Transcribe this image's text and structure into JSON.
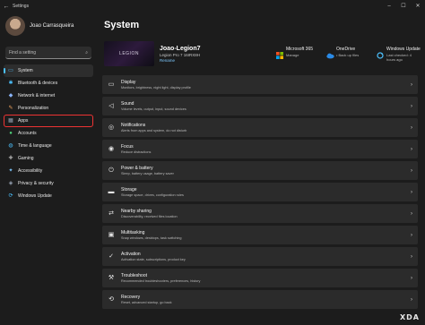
{
  "window": {
    "title": "Settings",
    "back_icon": "back-arrow-icon",
    "controls": [
      "–",
      "☐",
      "✕"
    ]
  },
  "user": {
    "name": "Joao Carrasqueira"
  },
  "search": {
    "placeholder": "Find a setting"
  },
  "sidebar": {
    "items": [
      {
        "label": "System",
        "icon": "system-icon",
        "color": "#4cc2ff",
        "active": true
      },
      {
        "label": "Bluetooth & devices",
        "icon": "bluetooth-icon",
        "color": "#4cc2ff"
      },
      {
        "label": "Network & internet",
        "icon": "network-icon",
        "color": "#8ab4f8"
      },
      {
        "label": "Personalization",
        "icon": "brush-icon",
        "color": "#f0a35e"
      },
      {
        "label": "Apps",
        "icon": "apps-icon",
        "color": "#9aa6b8",
        "highlighted": true
      },
      {
        "label": "Accounts",
        "icon": "accounts-icon",
        "color": "#4fd17a"
      },
      {
        "label": "Time & language",
        "icon": "globe-icon",
        "color": "#4cc2ff"
      },
      {
        "label": "Gaming",
        "icon": "gaming-icon",
        "color": "#b0b0b0"
      },
      {
        "label": "Accessibility",
        "icon": "accessibility-icon",
        "color": "#7ec8ff"
      },
      {
        "label": "Privacy & security",
        "icon": "shield-icon",
        "color": "#9aa6b8"
      },
      {
        "label": "Windows Update",
        "icon": "update-icon",
        "color": "#4cc2ff"
      }
    ]
  },
  "main": {
    "title": "System",
    "device": {
      "image_text": "LEGION",
      "name": "Joao-Legion7",
      "model": "Legion Pro 7 16IRX8H",
      "rename": "Rename"
    },
    "tiles": [
      {
        "name": "Microsoft 365",
        "sub": "Manage",
        "icon": "microsoft365-icon"
      },
      {
        "name": "OneDrive",
        "sub": "• Back up files",
        "icon": "onedrive-icon"
      },
      {
        "name": "Windows Update",
        "sub": "Last checked: 4 hours ago",
        "icon": "windows-update-icon"
      }
    ],
    "cards": [
      {
        "title": "Display",
        "sub": "Monitors, brightness, night light, display profile",
        "icon": "display-icon",
        "glyph": "▭"
      },
      {
        "title": "Sound",
        "sub": "Volume levels, output, input, sound devices",
        "icon": "sound-icon",
        "glyph": "◁"
      },
      {
        "title": "Notifications",
        "sub": "Alerts from apps and system, do not disturb",
        "icon": "bell-icon",
        "glyph": "◎"
      },
      {
        "title": "Focus",
        "sub": "Reduce distractions",
        "icon": "focus-icon",
        "glyph": "◉"
      },
      {
        "title": "Power & battery",
        "sub": "Sleep, battery usage, battery saver",
        "icon": "power-icon",
        "glyph": "⏻"
      },
      {
        "title": "Storage",
        "sub": "Storage space, drives, configuration rules",
        "icon": "storage-icon",
        "glyph": "▬"
      },
      {
        "title": "Nearby sharing",
        "sub": "Discoverability, received files location",
        "icon": "nearby-sharing-icon",
        "glyph": "⇄"
      },
      {
        "title": "Multitasking",
        "sub": "Snap windows, desktops, task switching",
        "icon": "multitasking-icon",
        "glyph": "▣"
      },
      {
        "title": "Activation",
        "sub": "Activation state, subscriptions, product key",
        "icon": "activation-icon",
        "glyph": "✓"
      },
      {
        "title": "Troubleshoot",
        "sub": "Recommended troubleshooters, preferences, history",
        "icon": "wrench-icon",
        "glyph": "⚒"
      },
      {
        "title": "Recovery",
        "sub": "Reset, advanced startup, go back",
        "icon": "recovery-icon",
        "glyph": "⟲"
      }
    ]
  },
  "watermark": "XDA"
}
